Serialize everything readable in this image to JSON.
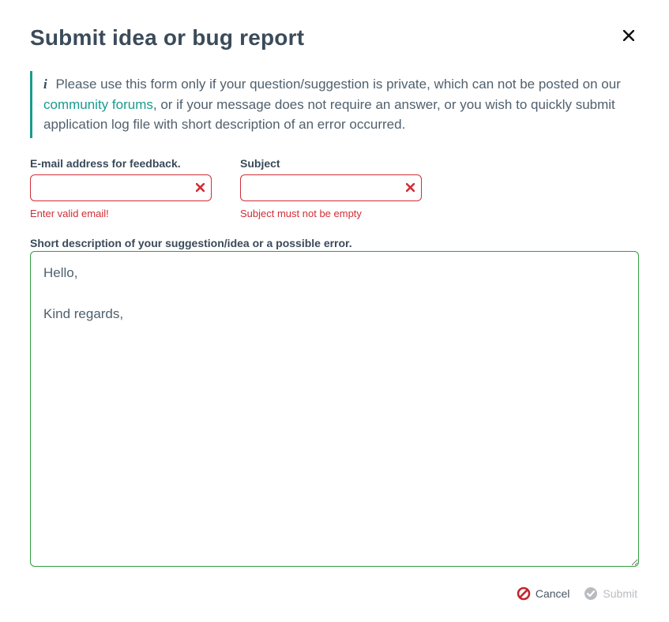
{
  "title": "Submit idea or bug report",
  "notice": {
    "text_prefix": "Please use this form only if your question/suggestion is private, which can not be posted on our ",
    "link_text": "community forums",
    "text_suffix": ", or if your message does not require an answer, or you wish to quickly submit application log file with short description of an error occurred."
  },
  "fields": {
    "email": {
      "label": "E-mail address for feedback.",
      "value": "",
      "error": "Enter valid email!"
    },
    "subject": {
      "label": "Subject",
      "value": "",
      "error": "Subject must not be empty"
    },
    "description": {
      "label": "Short description of your suggestion/idea or a possible error.",
      "value": "Hello,\n\nKind regards, "
    }
  },
  "buttons": {
    "cancel": "Cancel",
    "submit": "Submit"
  }
}
